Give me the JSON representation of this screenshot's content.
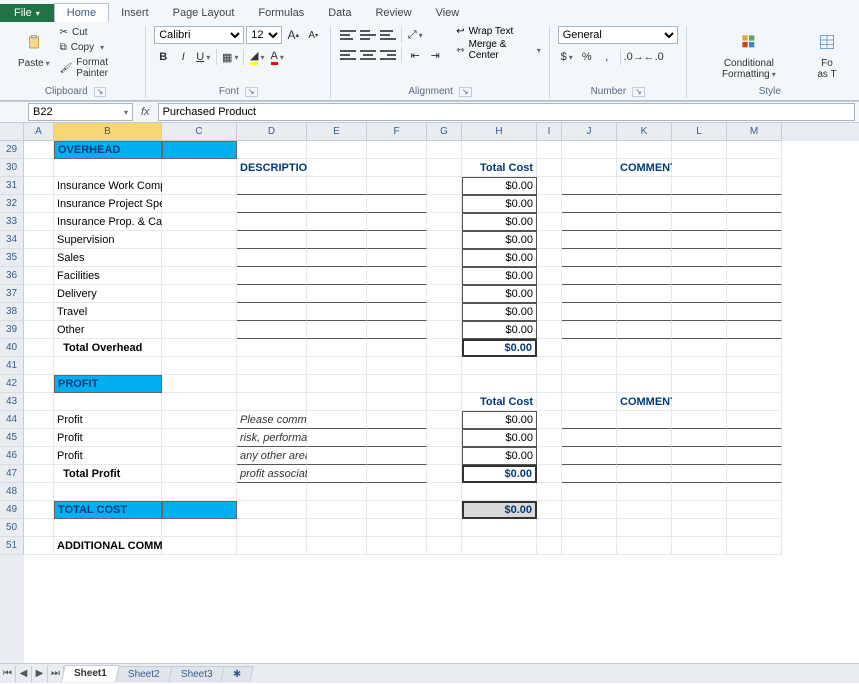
{
  "tabs": {
    "file": "File",
    "home": "Home",
    "insert": "Insert",
    "pagelayout": "Page Layout",
    "formulas": "Formulas",
    "data": "Data",
    "review": "Review",
    "view": "View"
  },
  "clipboard": {
    "paste": "Paste",
    "cut": "Cut",
    "copy": "Copy",
    "format_painter": "Format Painter",
    "label": "Clipboard"
  },
  "font": {
    "name": "Calibri",
    "size": "12",
    "label": "Font"
  },
  "alignment": {
    "wrap": "Wrap Text",
    "merge": "Merge & Center",
    "label": "Alignment"
  },
  "number": {
    "format": "General",
    "label": "Number"
  },
  "styles": {
    "conditional": "Conditional Formatting",
    "format_as": "Fo\nas T",
    "label": "Style"
  },
  "namebox": "B22",
  "formula": "Purchased Product",
  "columns": [
    "A",
    "B",
    "C",
    "D",
    "E",
    "F",
    "G",
    "H",
    "I",
    "J",
    "K",
    "L",
    "M"
  ],
  "rows_start": 29,
  "rows_end": 51,
  "sheet": {
    "overhead_title": "OVERHEAD",
    "description_hdr": "DESCRIPTION",
    "totalcost_hdr": "Total Cost",
    "comments_hdr": "COMMENTS / DETAIL",
    "overhead_items": [
      {
        "label": "Insurance Work Comp",
        "cost": "$0.00"
      },
      {
        "label": "Insurance Project Specific",
        "cost": "$0.00"
      },
      {
        "label": "Insurance Prop. & Casualty",
        "cost": "$0.00"
      },
      {
        "label": "Supervision",
        "cost": "$0.00"
      },
      {
        "label": "Sales",
        "cost": "$0.00"
      },
      {
        "label": "Facilities",
        "cost": "$0.00"
      },
      {
        "label": "Delivery",
        "cost": "$0.00"
      },
      {
        "label": "Travel",
        "cost": "$0.00"
      },
      {
        "label": "Other",
        "cost": "$0.00"
      }
    ],
    "total_overhead_label": "Total Overhead",
    "total_overhead_cost": "$0.00",
    "profit_title": "PROFIT",
    "profit_items": [
      {
        "label": "Profit",
        "desc": "Please comment on factors such as",
        "cost": "$0.00"
      },
      {
        "label": "Profit",
        "desc": "risk, performance, investment and",
        "cost": "$0.00"
      },
      {
        "label": "Profit",
        "desc": "any other area that influences the",
        "cost": "$0.00"
      }
    ],
    "total_profit_label": "Total Profit",
    "total_profit_desc": "profit associated with the bid.",
    "total_profit_cost": "$0.00",
    "totalcost_title": "TOTAL COST",
    "totalcost_value": "$0.00",
    "additional_comments": "ADDITIONAL COMMENTS:"
  },
  "sheets": {
    "s1": "Sheet1",
    "s2": "Sheet2",
    "s3": "Sheet3"
  }
}
